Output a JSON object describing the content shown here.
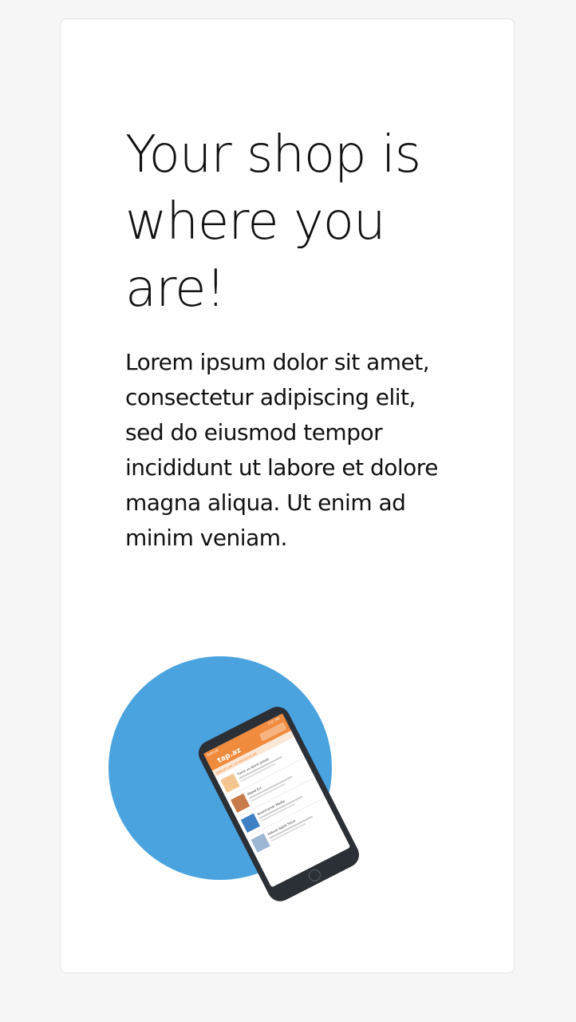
{
  "hero": {
    "title": "Your shop is where you are!",
    "description": "Lorem ipsum dolor sit amet, consectetur adipiscing elit, sed do eiusmod tempor incididunt ut labore et dolore magna aliqua. Ut enim ad minim veniam."
  },
  "illustration": {
    "circle_color": "#4aa3df",
    "phone_color": "#2b2f36",
    "app_accent": "#f08a3c",
    "app_logo": "tap.az",
    "app_tab": "ŞİRKƏTLƏR VƏ MAĞAZALAR",
    "app_status": "Azercell",
    "app_time": "5:07 PM",
    "app_listings": [
      "Təmir və tikinti şirkəti",
      "Mebel Evi",
      "Bookmarker Media",
      "Deluxe Apple Store"
    ]
  }
}
